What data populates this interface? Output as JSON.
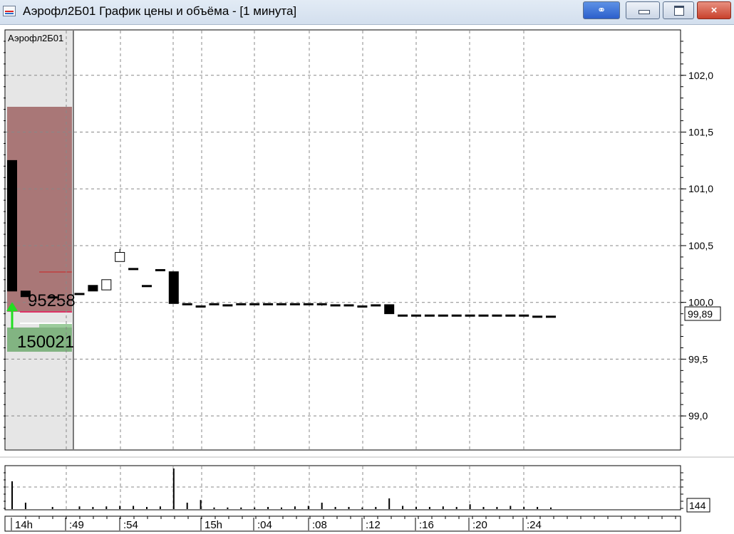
{
  "window": {
    "title": "Аэрофл2Б01 График цены и объёма - [1 минута]",
    "buttons": {
      "link": "link-icon",
      "minimize": "minimize-icon",
      "maximize": "maximize-icon",
      "close": "×"
    }
  },
  "price_panel": {
    "instrument_label": "Аэрофл2Б01",
    "current_price_label": "99,89",
    "order_book": {
      "ask_volume": "95258",
      "bid_volume": "150021"
    }
  },
  "volume_panel": {
    "last_volume_label": "144"
  },
  "colors": {
    "ask_zone": "#a97777",
    "bid_zone": "#82b482",
    "book_background": "#e6e6e6",
    "bid_arrow": "#22dd22",
    "ask_line": "#cc2222"
  },
  "chart_data": [
    {
      "type": "candlestick",
      "title": "",
      "ylim": [
        98.7,
        102.4
      ],
      "y_ticks": [
        "99,0",
        "99,5",
        "100,0",
        "100,5",
        "101,0",
        "101,5",
        "102,0"
      ],
      "x_ticks": [
        "14h",
        ":49",
        ":54",
        "15h",
        ":04",
        ":08",
        ":12",
        ":16",
        ":20",
        ":24"
      ],
      "candles": [
        {
          "i": 0,
          "o": 101.25,
          "h": 101.25,
          "l": 100.1,
          "c": 100.1
        },
        {
          "i": 1,
          "o": 100.1,
          "h": 100.1,
          "l": 100.05,
          "c": 100.05
        },
        {
          "i": 3,
          "o": 100.05,
          "h": 100.05,
          "l": 100.04,
          "c": 100.04
        },
        {
          "i": 5,
          "o": 100.08,
          "h": 100.08,
          "l": 100.07,
          "c": 100.07
        },
        {
          "i": 6,
          "o": 100.15,
          "h": 100.15,
          "l": 100.1,
          "c": 100.1
        },
        {
          "i": 7,
          "o": 100.11,
          "h": 100.2,
          "l": 100.11,
          "c": 100.2
        },
        {
          "i": 8,
          "o": 100.36,
          "h": 100.47,
          "l": 100.36,
          "c": 100.44
        },
        {
          "i": 9,
          "o": 100.3,
          "h": 100.3,
          "l": 100.29,
          "c": 100.29
        },
        {
          "i": 10,
          "o": 100.15,
          "h": 100.15,
          "l": 100.14,
          "c": 100.14
        },
        {
          "i": 11,
          "o": 100.29,
          "h": 100.29,
          "l": 100.28,
          "c": 100.28
        },
        {
          "i": 12,
          "o": 100.27,
          "h": 100.27,
          "l": 99.99,
          "c": 99.99
        },
        {
          "i": 13,
          "o": 99.99,
          "h": 99.99,
          "l": 99.98,
          "c": 99.98
        },
        {
          "i": 14,
          "o": 99.97,
          "h": 99.97,
          "l": 99.96,
          "c": 99.96
        },
        {
          "i": 15,
          "o": 99.99,
          "h": 99.99,
          "l": 99.98,
          "c": 99.98
        },
        {
          "i": 16,
          "o": 99.98,
          "h": 99.98,
          "l": 99.97,
          "c": 99.97
        },
        {
          "i": 17,
          "o": 99.99,
          "h": 99.99,
          "l": 99.98,
          "c": 99.98
        },
        {
          "i": 18,
          "o": 99.99,
          "h": 99.99,
          "l": 99.98,
          "c": 99.98
        },
        {
          "i": 19,
          "o": 99.99,
          "h": 99.99,
          "l": 99.98,
          "c": 99.98
        },
        {
          "i": 20,
          "o": 99.99,
          "h": 99.99,
          "l": 99.98,
          "c": 99.98
        },
        {
          "i": 21,
          "o": 99.99,
          "h": 99.99,
          "l": 99.98,
          "c": 99.98
        },
        {
          "i": 22,
          "o": 99.99,
          "h": 99.99,
          "l": 99.98,
          "c": 99.98
        },
        {
          "i": 23,
          "o": 99.99,
          "h": 99.99,
          "l": 99.97,
          "c": 99.98
        },
        {
          "i": 24,
          "o": 99.98,
          "h": 99.98,
          "l": 99.97,
          "c": 99.97
        },
        {
          "i": 25,
          "o": 99.98,
          "h": 99.98,
          "l": 99.97,
          "c": 99.97
        },
        {
          "i": 26,
          "o": 99.97,
          "h": 99.97,
          "l": 99.96,
          "c": 99.96
        },
        {
          "i": 27,
          "o": 99.98,
          "h": 99.98,
          "l": 99.97,
          "c": 99.97
        },
        {
          "i": 28,
          "o": 99.98,
          "h": 99.98,
          "l": 99.9,
          "c": 99.9
        },
        {
          "i": 29,
          "o": 99.89,
          "h": 99.89,
          "l": 99.88,
          "c": 99.88
        },
        {
          "i": 30,
          "o": 99.89,
          "h": 99.89,
          "l": 99.88,
          "c": 99.88
        },
        {
          "i": 31,
          "o": 99.89,
          "h": 99.89,
          "l": 99.88,
          "c": 99.88
        },
        {
          "i": 32,
          "o": 99.89,
          "h": 99.89,
          "l": 99.88,
          "c": 99.88
        },
        {
          "i": 33,
          "o": 99.89,
          "h": 99.89,
          "l": 99.88,
          "c": 99.88
        },
        {
          "i": 34,
          "o": 99.89,
          "h": 99.89,
          "l": 99.88,
          "c": 99.88
        },
        {
          "i": 35,
          "o": 99.89,
          "h": 99.89,
          "l": 99.88,
          "c": 99.88
        },
        {
          "i": 36,
          "o": 99.89,
          "h": 99.89,
          "l": 99.88,
          "c": 99.88
        },
        {
          "i": 37,
          "o": 99.89,
          "h": 99.89,
          "l": 99.88,
          "c": 99.88
        },
        {
          "i": 38,
          "o": 99.89,
          "h": 99.89,
          "l": 99.88,
          "c": 99.88
        },
        {
          "i": 39,
          "o": 99.88,
          "h": 99.88,
          "l": 99.87,
          "c": 99.87
        },
        {
          "i": 40,
          "o": 99.88,
          "h": 99.88,
          "l": 99.87,
          "c": 99.87
        }
      ]
    },
    {
      "type": "bar",
      "title": "",
      "ylim": [
        0,
        400
      ],
      "volumes": [
        {
          "i": 0,
          "v": 260
        },
        {
          "i": 1,
          "v": 60
        },
        {
          "i": 3,
          "v": 20
        },
        {
          "i": 5,
          "v": 25
        },
        {
          "i": 6,
          "v": 20
        },
        {
          "i": 7,
          "v": 25
        },
        {
          "i": 8,
          "v": 30
        },
        {
          "i": 9,
          "v": 30
        },
        {
          "i": 10,
          "v": 20
        },
        {
          "i": 11,
          "v": 25
        },
        {
          "i": 12,
          "v": 380
        },
        {
          "i": 13,
          "v": 60
        },
        {
          "i": 14,
          "v": 85
        },
        {
          "i": 15,
          "v": 15
        },
        {
          "i": 16,
          "v": 15
        },
        {
          "i": 17,
          "v": 15
        },
        {
          "i": 18,
          "v": 15
        },
        {
          "i": 19,
          "v": 20
        },
        {
          "i": 20,
          "v": 15
        },
        {
          "i": 21,
          "v": 25
        },
        {
          "i": 22,
          "v": 30
        },
        {
          "i": 23,
          "v": 60
        },
        {
          "i": 24,
          "v": 20
        },
        {
          "i": 25,
          "v": 20
        },
        {
          "i": 26,
          "v": 15
        },
        {
          "i": 27,
          "v": 20
        },
        {
          "i": 28,
          "v": 100
        },
        {
          "i": 29,
          "v": 30
        },
        {
          "i": 30,
          "v": 20
        },
        {
          "i": 31,
          "v": 20
        },
        {
          "i": 32,
          "v": 25
        },
        {
          "i": 33,
          "v": 20
        },
        {
          "i": 34,
          "v": 45
        },
        {
          "i": 35,
          "v": 20
        },
        {
          "i": 36,
          "v": 20
        },
        {
          "i": 37,
          "v": 30
        },
        {
          "i": 38,
          "v": 20
        },
        {
          "i": 39,
          "v": 20
        },
        {
          "i": 40,
          "v": 15
        }
      ]
    }
  ]
}
